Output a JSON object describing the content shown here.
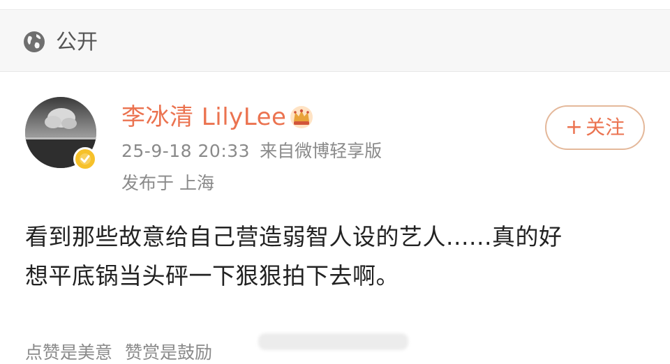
{
  "visibility": {
    "icon": "globe-icon",
    "label": "公开"
  },
  "post": {
    "author": {
      "name": "李冰清 LilyLee",
      "badge_icon": "crown-icon",
      "verified_icon": "verified-badge-icon"
    },
    "time": "25-9-18 20:33",
    "source": "来自微博轻享版",
    "location_prefix": "发布于",
    "location": "上海",
    "follow_label": "关注",
    "text_line1": "看到那些故意给自己营造弱智人设的艺人......真的好",
    "text_line2": "想平底锅当头砰一下狠狠拍下去啊。"
  },
  "footer": {
    "left": "点赞是美意",
    "right": "赞赏是鼓励"
  },
  "colors": {
    "accent": "#eb7350",
    "meta": "#8a8a8a",
    "verified": "#f6c12a"
  }
}
